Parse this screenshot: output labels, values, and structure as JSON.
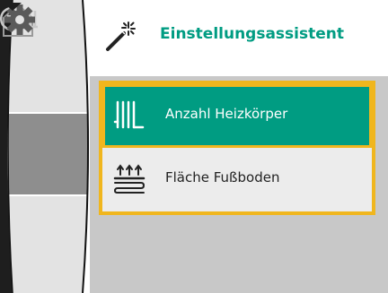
{
  "header": {
    "title": "Einstellungsassistent",
    "icon": "magic-wand-icon",
    "title_color": "#009c82"
  },
  "left_rail": {
    "items": [
      {
        "icon": "home-icon",
        "selected": false
      },
      {
        "icon": "hydraulic-system-icon",
        "selected": true
      },
      {
        "icon": "gear-icon",
        "selected": false
      }
    ],
    "scroll_indicator": "chevron-down-icon"
  },
  "menu": {
    "items": [
      {
        "label": "Anzahl Heizkörper",
        "icon": "radiator-icon",
        "selected": true
      },
      {
        "label": "Fläche Fußboden",
        "icon": "underfloor-heating-icon",
        "selected": false
      }
    ]
  },
  "colors": {
    "accent": "#009c82",
    "focus_border": "#f0b61e",
    "background": "#c8c8c8"
  }
}
